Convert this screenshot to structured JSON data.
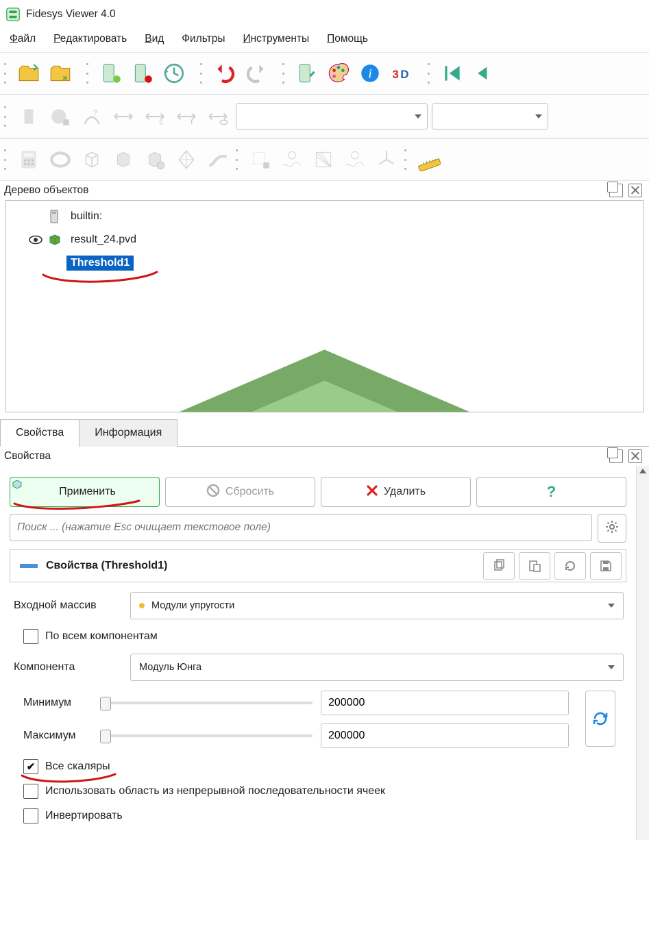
{
  "app": {
    "title": "Fidesys Viewer 4.0"
  },
  "menu": {
    "file": "Файл",
    "edit": "Редактировать",
    "view": "Вид",
    "filters": "Фильтры",
    "tools": "Инструменты",
    "help": "Помощь"
  },
  "tree": {
    "title": "Дерево объектов",
    "items": [
      {
        "label": "builtin:",
        "icon": "server",
        "visible": null,
        "selected": false
      },
      {
        "label": "result_24.pvd",
        "icon": "cube-green",
        "visible": true,
        "selected": false
      },
      {
        "label": "Threshold1",
        "icon": "cube-faded",
        "visible": false,
        "selected": true
      }
    ]
  },
  "tabs": {
    "properties": "Свойства",
    "information": "Информация",
    "active": "properties"
  },
  "props": {
    "panel_title": "Свойства",
    "apply": "Применить",
    "reset": "Сбросить",
    "delete": "Удалить",
    "search_placeholder": "Поиск ... (нажатие Esc очищает текстовое поле)",
    "section_title": "Свойства (Threshold1)",
    "input_array_label": "Входной массив",
    "input_array_value": "Модули упругости",
    "all_components": "По всем компонентам",
    "component_label": "Компонента",
    "component_value": "Модуль Юнга",
    "minimum_label": "Минимум",
    "minimum_value": "200000",
    "maximum_label": "Максимум",
    "maximum_value": "200000",
    "all_scalars": "Все скаляры",
    "use_continuous": "Использовать область из непрерывной последовательности ячеек",
    "invert": "Инвертировать",
    "checks": {
      "all_components": false,
      "all_scalars": true,
      "use_continuous": false,
      "invert": false
    }
  }
}
